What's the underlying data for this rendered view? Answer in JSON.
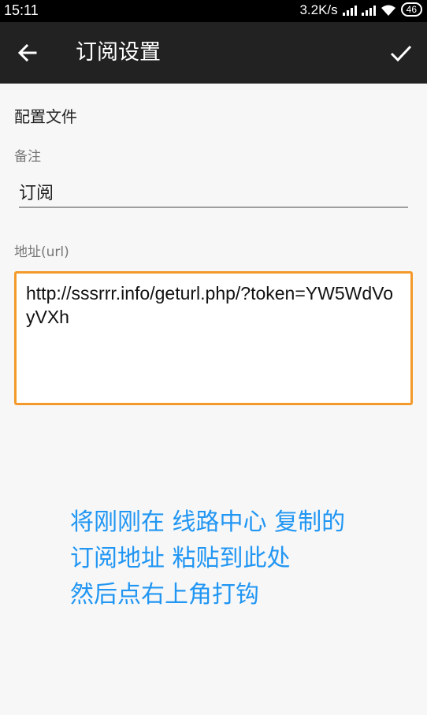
{
  "status_bar": {
    "time": "15:11",
    "network_speed": "3.2K/s",
    "battery": "46",
    "icons": [
      "signal-icon",
      "signal-icon",
      "wifi-icon",
      "battery-icon"
    ]
  },
  "toolbar": {
    "title": "订阅设置",
    "back_icon": "arrow-left-icon",
    "confirm_icon": "check-icon"
  },
  "form": {
    "section_title": "配置文件",
    "remark_label": "备注",
    "remark_value": "订阅",
    "url_label": "地址(url)",
    "url_value": "http://sssrrr.info/geturl.php/?token=YW5WdVoyVXh"
  },
  "instruction": {
    "line1": "将刚刚在 线路中心 复制的",
    "line2": "订阅地址 粘贴到此处",
    "line3": "然后点右上角打钩"
  },
  "colors": {
    "accent_orange": "#f39a2b",
    "instruction_blue": "#2196f3",
    "toolbar": "#222222"
  }
}
